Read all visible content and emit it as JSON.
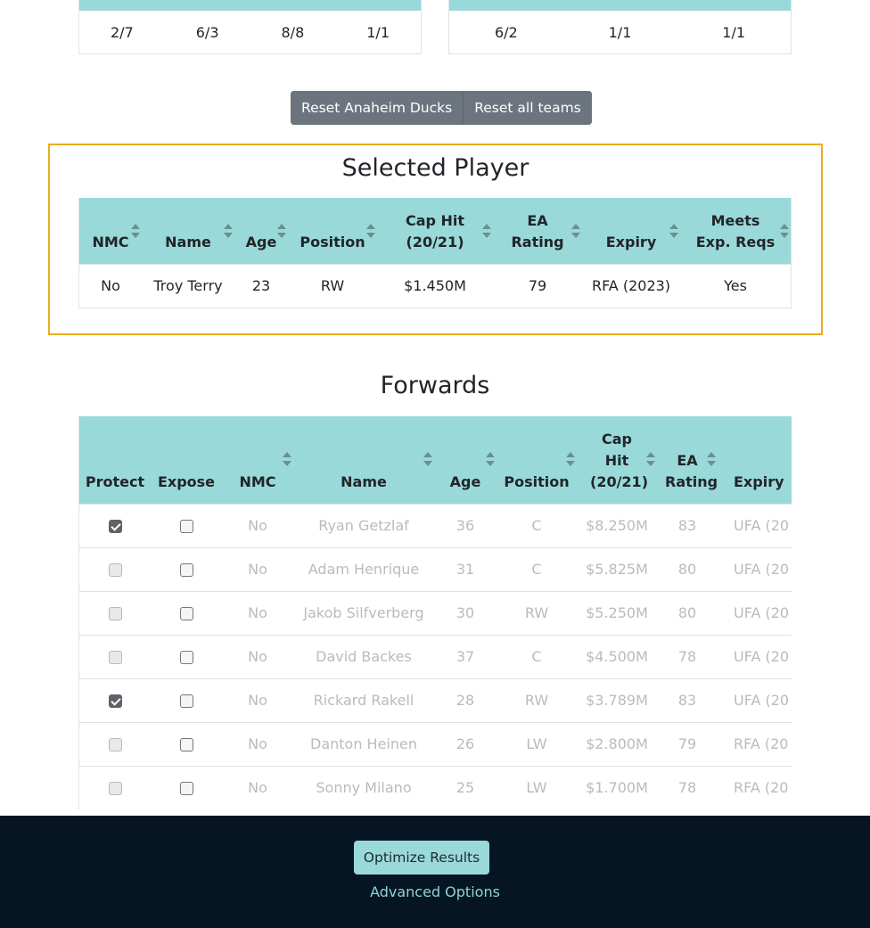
{
  "summary": {
    "left": [
      "2/7",
      "6/3",
      "8/8",
      "1/1"
    ],
    "right": [
      "6/2",
      "1/1",
      "1/1"
    ]
  },
  "buttons": {
    "reset_team": "Reset Anaheim Ducks",
    "reset_all": "Reset all teams"
  },
  "selected_player": {
    "title": "Selected Player",
    "headers": {
      "nmc": "NMC",
      "name": "Name",
      "age": "Age",
      "position": "Position",
      "cap_hit": "Cap Hit (20/21)",
      "ea_rating": "EA Rating",
      "expiry": "Expiry",
      "meets": "Meets Exp. Reqs"
    },
    "row": {
      "nmc": "No",
      "name": "Troy Terry",
      "age": "23",
      "position": "RW",
      "cap_hit": "$1.450M",
      "ea_rating": "79",
      "expiry": "RFA (2023)",
      "meets": "Yes"
    }
  },
  "forwards": {
    "title": "Forwards",
    "headers": {
      "protect": "Protect",
      "expose": "Expose",
      "nmc": "NMC",
      "name": "Name",
      "age": "Age",
      "position": "Position",
      "cap_hit": "Cap Hit (20/21)",
      "ea_rating": "EA Rating",
      "expiry": "Expiry"
    },
    "rows": [
      {
        "protect": true,
        "expose": false,
        "nmc": "No",
        "name": "Ryan Getzlaf",
        "age": "36",
        "position": "C",
        "cap_hit": "$8.250M",
        "ea_rating": "83",
        "expiry": "UFA (20"
      },
      {
        "protect": false,
        "expose": false,
        "nmc": "No",
        "name": "Adam Henrique",
        "age": "31",
        "position": "C",
        "cap_hit": "$5.825M",
        "ea_rating": "80",
        "expiry": "UFA (20"
      },
      {
        "protect": false,
        "expose": false,
        "nmc": "No",
        "name": "Jakob Silfverberg",
        "age": "30",
        "position": "RW",
        "cap_hit": "$5.250M",
        "ea_rating": "80",
        "expiry": "UFA (20"
      },
      {
        "protect": false,
        "expose": false,
        "nmc": "No",
        "name": "David Backes",
        "age": "37",
        "position": "C",
        "cap_hit": "$4.500M",
        "ea_rating": "78",
        "expiry": "UFA (20"
      },
      {
        "protect": true,
        "expose": false,
        "nmc": "No",
        "name": "Rickard Rakell",
        "age": "28",
        "position": "RW",
        "cap_hit": "$3.789M",
        "ea_rating": "83",
        "expiry": "UFA (20"
      },
      {
        "protect": false,
        "expose": false,
        "nmc": "No",
        "name": "Danton Heinen",
        "age": "26",
        "position": "LW",
        "cap_hit": "$2.800M",
        "ea_rating": "79",
        "expiry": "RFA (20"
      },
      {
        "protect": false,
        "expose": false,
        "nmc": "No",
        "name": "Sonny Milano",
        "age": "25",
        "position": "LW",
        "cap_hit": "$1.700M",
        "ea_rating": "78",
        "expiry": "RFA (20"
      }
    ]
  },
  "footer": {
    "optimize": "Optimize Results",
    "advanced": "Advanced Options"
  },
  "colors": {
    "header_teal": "#9ad9da",
    "selected_border": "#eaac1b",
    "footer_bg": "#061524",
    "reset_gray": "#6c757d"
  }
}
